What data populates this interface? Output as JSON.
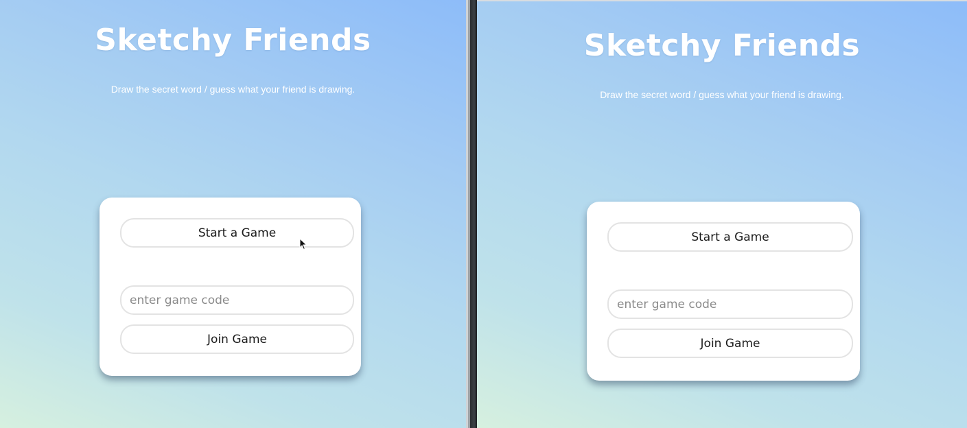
{
  "screens": [
    {
      "title": "Sketchy Friends",
      "subtitle": "Draw the secret word / guess what your friend is drawing.",
      "start_button": "Start a Game",
      "code_input": {
        "value": "",
        "placeholder": "enter game code"
      },
      "join_button": "Join Game"
    },
    {
      "title": "Sketchy Friends",
      "subtitle": "Draw the secret word / guess what your friend is drawing.",
      "start_button": "Start a Game",
      "code_input": {
        "value": "",
        "placeholder": "enter game code"
      },
      "join_button": "Join Game"
    }
  ],
  "colors": {
    "gradient_start": "#d6f0df",
    "gradient_end": "#8dbcf9",
    "card": "#ffffff",
    "pill_border": "#e3e3e3",
    "text": "#1a1a1a",
    "placeholder": "#8a8a8a"
  },
  "icons": {
    "mouse_pointer": "mouse-pointer-icon"
  }
}
